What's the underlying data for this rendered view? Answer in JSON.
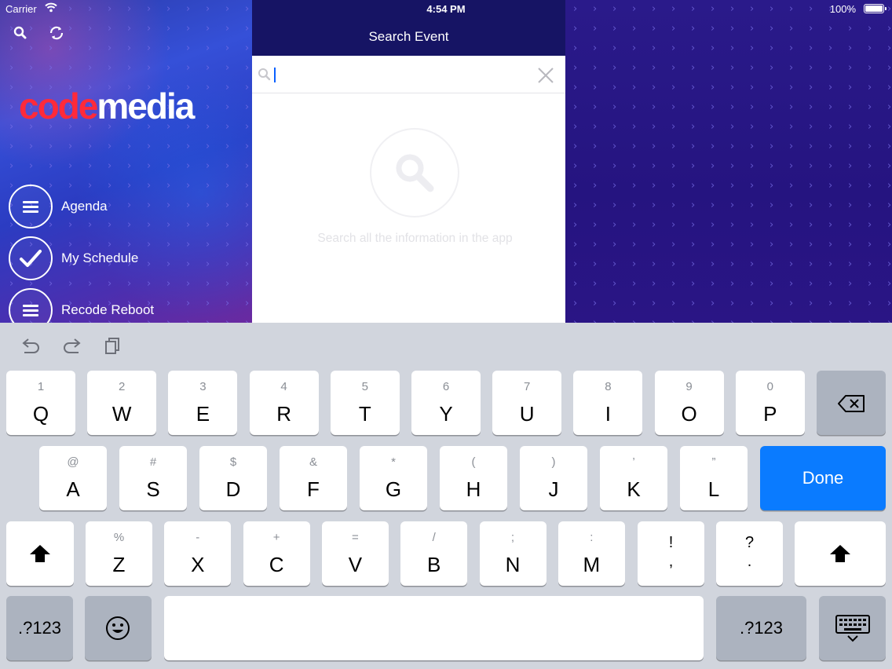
{
  "status_bar": {
    "carrier": "Carrier",
    "time": "4:54 PM",
    "battery": "100%",
    "wifi_icon": "wifi-icon",
    "battery_icon": "battery-icon"
  },
  "sidebar": {
    "logo": {
      "part1": "code",
      "part2": "media"
    },
    "top_icons": [
      "search-icon",
      "refresh-icon"
    ],
    "menu": [
      {
        "label": "Agenda",
        "icon": "list-icon"
      },
      {
        "label": "My Schedule",
        "icon": "checkmark-icon"
      },
      {
        "label": "Recode Reboot",
        "icon": "list-icon"
      }
    ]
  },
  "search_modal": {
    "title": "Search Event",
    "input_value": "",
    "empty_text": "Search all the information in the app"
  },
  "keyboard": {
    "toolbar": [
      "undo-icon",
      "redo-icon",
      "paste-icon"
    ],
    "row1": [
      {
        "num": "1",
        "letter": "Q"
      },
      {
        "num": "2",
        "letter": "W"
      },
      {
        "num": "3",
        "letter": "E"
      },
      {
        "num": "4",
        "letter": "R"
      },
      {
        "num": "5",
        "letter": "T"
      },
      {
        "num": "6",
        "letter": "Y"
      },
      {
        "num": "7",
        "letter": "U"
      },
      {
        "num": "8",
        "letter": "I"
      },
      {
        "num": "9",
        "letter": "O"
      },
      {
        "num": "0",
        "letter": "P"
      }
    ],
    "row2": [
      {
        "num": "@",
        "letter": "A"
      },
      {
        "num": "#",
        "letter": "S"
      },
      {
        "num": "$",
        "letter": "D"
      },
      {
        "num": "&",
        "letter": "F"
      },
      {
        "num": "*",
        "letter": "G"
      },
      {
        "num": "(",
        "letter": "H"
      },
      {
        "num": ")",
        "letter": "J"
      },
      {
        "num": "’",
        "letter": "K"
      },
      {
        "num": "”",
        "letter": "L"
      }
    ],
    "row3": [
      {
        "num": "%",
        "letter": "Z"
      },
      {
        "num": "-",
        "letter": "X"
      },
      {
        "num": "+",
        "letter": "C"
      },
      {
        "num": "=",
        "letter": "V"
      },
      {
        "num": "/",
        "letter": "B"
      },
      {
        "num": ";",
        "letter": "N"
      },
      {
        "num": ":",
        "letter": "M"
      }
    ],
    "row3_punct": [
      {
        "top": "!",
        "bottom": ","
      },
      {
        "top": "?",
        "bottom": "."
      }
    ],
    "done_label": "Done",
    "numbers_label": ".?123"
  }
}
